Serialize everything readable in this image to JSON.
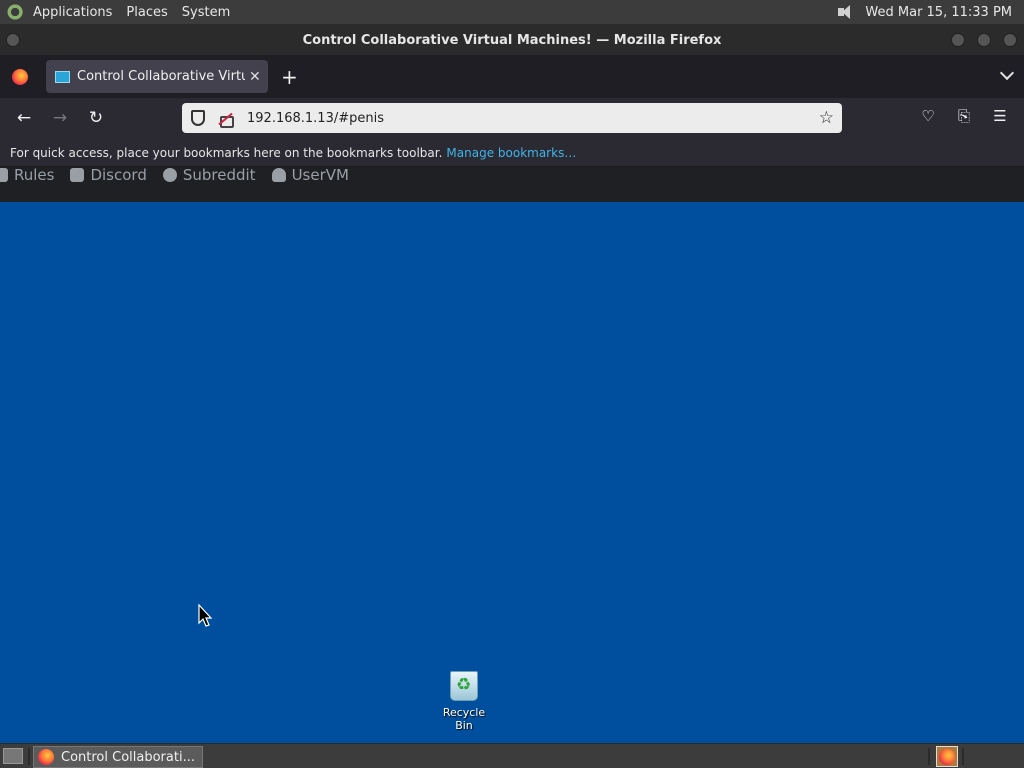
{
  "top_panel": {
    "menus": [
      "Applications",
      "Places",
      "System"
    ],
    "clock": "Wed Mar 15, 11:33 PM"
  },
  "window": {
    "title": "Control Collaborative Virtual Machines! — Mozilla Firefox"
  },
  "tabs": [
    {
      "label": "Control Collaborative Virtual Machines!",
      "active": true
    }
  ],
  "navbar": {
    "url": "192.168.1.13/#penis"
  },
  "bookmarks_toolbar": {
    "message": "For quick access, place your bookmarks here on the bookmarks toolbar.",
    "link": "Manage bookmarks…"
  },
  "page_nav": {
    "items": [
      "Rules",
      "Discord",
      "Subreddit",
      "UserVM"
    ]
  },
  "desktop": {
    "background": "#004f9e",
    "icons": [
      {
        "label": "Recycle Bin"
      }
    ]
  },
  "taskbar": {
    "tasks": [
      {
        "label": "Control Collaborati..."
      }
    ]
  }
}
